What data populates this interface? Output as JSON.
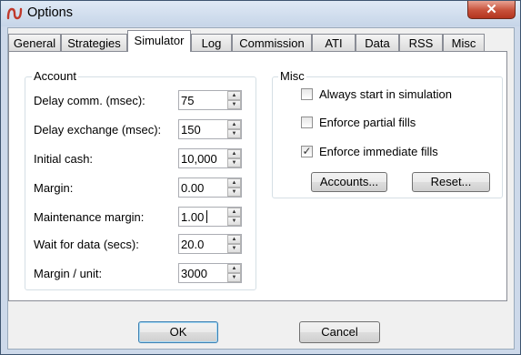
{
  "window": {
    "title": "Options",
    "close_symbol": "✕"
  },
  "tabs": [
    {
      "label": "General"
    },
    {
      "label": "Strategies"
    },
    {
      "label": "Simulator",
      "active": true
    },
    {
      "label": "Log"
    },
    {
      "label": "Commission"
    },
    {
      "label": "ATI"
    },
    {
      "label": "Data"
    },
    {
      "label": "RSS"
    },
    {
      "label": "Misc"
    }
  ],
  "account": {
    "title": "Account",
    "fields": [
      {
        "label": "Delay comm. (msec):",
        "value": "75"
      },
      {
        "label": "Delay exchange (msec):",
        "value": "150"
      },
      {
        "label": "Initial cash:",
        "value": "10,000"
      },
      {
        "label": "Margin:",
        "value": "0.00"
      },
      {
        "label": "Maintenance margin:",
        "value": "1.00"
      },
      {
        "label": "Wait for data (secs):",
        "value": "20.0"
      },
      {
        "label": "Margin / unit:",
        "value": "3000"
      }
    ]
  },
  "misc": {
    "title": "Misc",
    "checkboxes": [
      {
        "label": "Always start in simulation",
        "checked": false
      },
      {
        "label": "Enforce partial fills",
        "checked": false
      },
      {
        "label": "Enforce immediate fills",
        "checked": true
      }
    ],
    "accounts_button": "Accounts...",
    "reset_button": "Reset..."
  },
  "footer": {
    "ok_label": "OK",
    "cancel_label": "Cancel"
  },
  "colors": {
    "titlebar": "#cdd9ea",
    "close": "#c7503a",
    "panel": "#ffffff",
    "dialog": "#f0f0f0"
  },
  "icons": {
    "app": "ninjatrader-logo-icon",
    "close": "close-icon",
    "spin_up": "spin-up-icon",
    "spin_down": "spin-down-icon",
    "check": "checkmark-icon"
  }
}
